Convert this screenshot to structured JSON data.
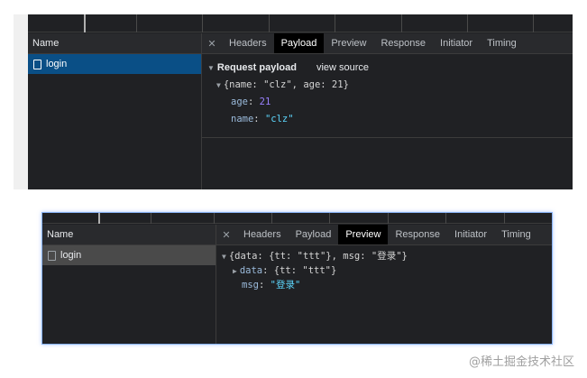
{
  "panel1": {
    "name_header": "Name",
    "request": "login",
    "tabs": [
      "Headers",
      "Payload",
      "Preview",
      "Response",
      "Initiator",
      "Timing"
    ],
    "active_tab": "Payload",
    "payload": {
      "section_title": "Request payload",
      "view_source": "view source",
      "summary": "{name: \"clz\", age: 21}",
      "fields": [
        {
          "key": "age",
          "sep": ": ",
          "value": "21",
          "type": "num"
        },
        {
          "key": "name",
          "sep": ": ",
          "value": "\"clz\"",
          "type": "str"
        }
      ]
    }
  },
  "panel2": {
    "name_header": "Name",
    "request": "login",
    "tabs": [
      "Headers",
      "Payload",
      "Preview",
      "Response",
      "Initiator",
      "Timing"
    ],
    "active_tab": "Preview",
    "preview": {
      "summary": "{data: {tt: \"ttt\"}, msg: \"登录\"}",
      "data_key": "data",
      "data_value": "{tt: \"ttt\"}",
      "msg_key": "msg",
      "msg_value": "\"登录\""
    }
  },
  "watermark": "@稀土掘金技术社区",
  "colors": {
    "background": "#202124",
    "selected_row_blue": "#0a4f86",
    "selected_row_grey": "#4a4a4a",
    "active_tab": "#000000",
    "string_value": "#5cd5fb",
    "number_value": "#9980ff",
    "key": "#9bbbdc",
    "focus_border": "#8ab4f8"
  },
  "icons": {
    "close": "close-icon",
    "document": "document-icon",
    "expand": "triangle-down-icon",
    "collapse": "triangle-right-icon"
  }
}
